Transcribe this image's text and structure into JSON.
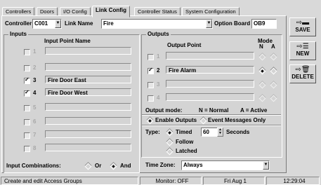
{
  "tabs": [
    {
      "label": "Controllers"
    },
    {
      "label": "Doors"
    },
    {
      "label": "I/O Config"
    },
    {
      "label": "Link Config"
    },
    {
      "label": "Controller Status"
    },
    {
      "label": "System Configuration"
    }
  ],
  "header": {
    "controller_label": "Controller",
    "controller_value": "C001",
    "link_name_label": "Link Name",
    "link_name_value": "Fire",
    "option_board_label": "Option Board",
    "option_board_value": "OB9"
  },
  "inputs": {
    "title": "Inputs",
    "column_header": "Input Point Name",
    "rows": [
      {
        "num": "1",
        "checked": false,
        "enabled": false,
        "name": ""
      },
      {
        "num": "2",
        "checked": false,
        "enabled": false,
        "name": ""
      },
      {
        "num": "3",
        "checked": true,
        "enabled": true,
        "name": "Fire Door East"
      },
      {
        "num": "4",
        "checked": true,
        "enabled": true,
        "name": "Fire Door West"
      },
      {
        "num": "5",
        "checked": false,
        "enabled": false,
        "name": ""
      },
      {
        "num": "6",
        "checked": false,
        "enabled": false,
        "name": ""
      },
      {
        "num": "7",
        "checked": false,
        "enabled": false,
        "name": ""
      },
      {
        "num": "8",
        "checked": false,
        "enabled": false,
        "name": ""
      }
    ],
    "combinations_label": "Input Combinations:",
    "or_label": "Or",
    "and_label": "And",
    "combination_selected": "And"
  },
  "outputs": {
    "title": "Outputs",
    "column_header": "Output Point",
    "mode_header": "Mode",
    "mode_n": "N",
    "mode_a": "A",
    "rows": [
      {
        "num": "1",
        "checked": false,
        "enabled": false,
        "name": "",
        "mode": ""
      },
      {
        "num": "2",
        "checked": true,
        "enabled": true,
        "name": "Fire Alarm",
        "mode": "N"
      },
      {
        "num": "3",
        "checked": false,
        "enabled": false,
        "name": "",
        "mode": ""
      },
      {
        "num": "4",
        "checked": false,
        "enabled": false,
        "name": "",
        "mode": ""
      }
    ],
    "output_mode_label": "Output mode:",
    "normal_legend": "N = Normal",
    "active_legend": "A = Active",
    "enable_outputs_label": "Enable Outputs",
    "event_messages_label": "Event Messages Only",
    "type_label": "Type:",
    "timed_label": "Timed",
    "timed_seconds": "60",
    "seconds_label": "Seconds",
    "follow_label": "Follow",
    "latched_label": "Latched"
  },
  "time_zone": {
    "label": "Time Zone:",
    "value": "Always"
  },
  "side_buttons": {
    "save": "SAVE",
    "new": "NEW",
    "delete": "DELETE"
  },
  "status_bar": {
    "message": "Create and edit Access Groups",
    "monitor": "Monitor: OFF",
    "date": "Fri Aug 1",
    "time": "12:29:04"
  }
}
